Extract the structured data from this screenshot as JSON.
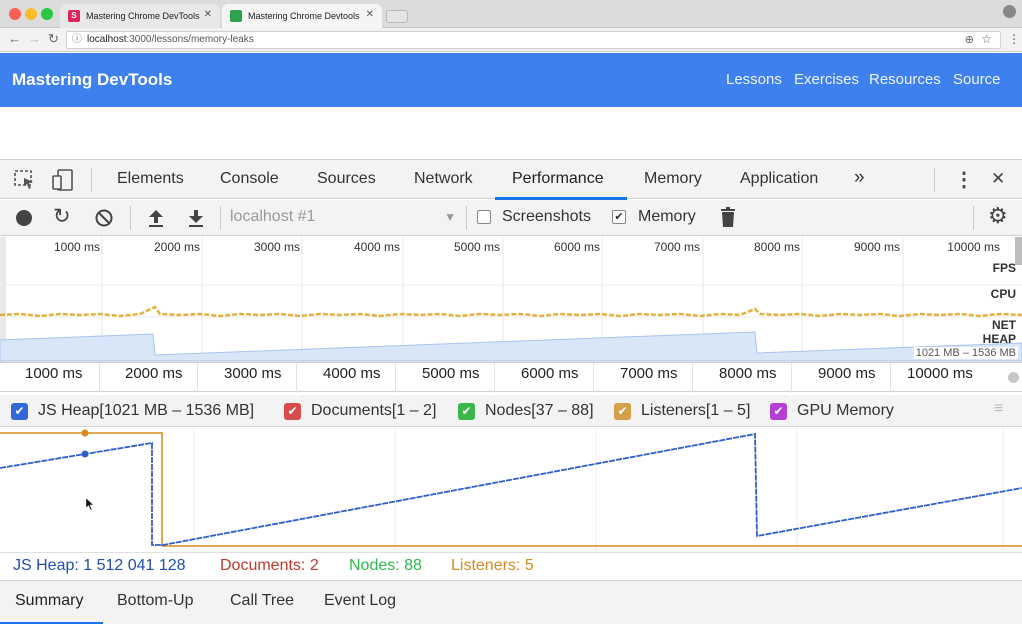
{
  "browser": {
    "tabs": [
      {
        "title": "Mastering Chrome DevTools",
        "favicon": "S",
        "favicon_color": "#e0245e"
      },
      {
        "title": "Mastering Chrome Devtools",
        "favicon": "",
        "favicon_color": "#2ca24b"
      }
    ],
    "url_host": "localhost",
    "url_path": ":3000/lessons/memory-leaks"
  },
  "site": {
    "title": "Mastering DevTools",
    "nav": [
      "Lessons",
      "Exercises",
      "Resources",
      "Source"
    ]
  },
  "devtools": {
    "panels": [
      "Elements",
      "Console",
      "Sources",
      "Network",
      "Performance",
      "Memory",
      "Application"
    ],
    "active_panel": "Performance",
    "more_label": "»",
    "close_label": "✕",
    "toolbar": {
      "profile_select": "localhost #1",
      "screenshots_label": "Screenshots",
      "screenshots_checked": false,
      "memory_label": "Memory",
      "memory_checked": true
    },
    "overview": {
      "ticks": [
        "1000 ms",
        "2000 ms",
        "3000 ms",
        "4000 ms",
        "5000 ms",
        "6000 ms",
        "7000 ms",
        "8000 ms",
        "9000 ms",
        "10000 ms"
      ],
      "track_labels": [
        "FPS",
        "CPU",
        "NET",
        "HEAP"
      ],
      "heap_range": "1021 MB – 1536 MB"
    },
    "ruler_ticks": [
      "1000 ms",
      "2000 ms",
      "3000 ms",
      "4000 ms",
      "5000 ms",
      "6000 ms",
      "7000 ms",
      "8000 ms",
      "9000 ms",
      "10000 ms"
    ],
    "legend": [
      {
        "label": "JS Heap[1021 MB – 1536 MB]",
        "color": "#3369d6",
        "checked": true
      },
      {
        "label": "Documents[1 – 2]",
        "color": "#d64c4c",
        "checked": true
      },
      {
        "label": "Nodes[37 – 88]",
        "color": "#3cb54a",
        "checked": true
      },
      {
        "label": "Listeners[1 – 5]",
        "color": "#d6a04a",
        "checked": true
      },
      {
        "label": "GPU Memory",
        "color": "#b43fd4",
        "checked": true
      }
    ],
    "counters": {
      "js_heap": "JS Heap: 1 512 041 128",
      "documents": "Documents: 2",
      "nodes": "Nodes: 88",
      "listeners": "Listeners: 5"
    },
    "bottom_tabs": [
      "Summary",
      "Bottom-Up",
      "Call Tree",
      "Event Log"
    ],
    "active_bottom_tab": "Summary"
  },
  "colors": {
    "accent": "#1a73e8",
    "site_header": "#3d80ee",
    "heap_line": "#2f5fc6",
    "listeners_line": "#d68a1e",
    "documents_text": "#c0392b",
    "nodes_text": "#2fb84a",
    "listeners_text": "#d68a1e",
    "heap_text": "#1f4fa8"
  }
}
